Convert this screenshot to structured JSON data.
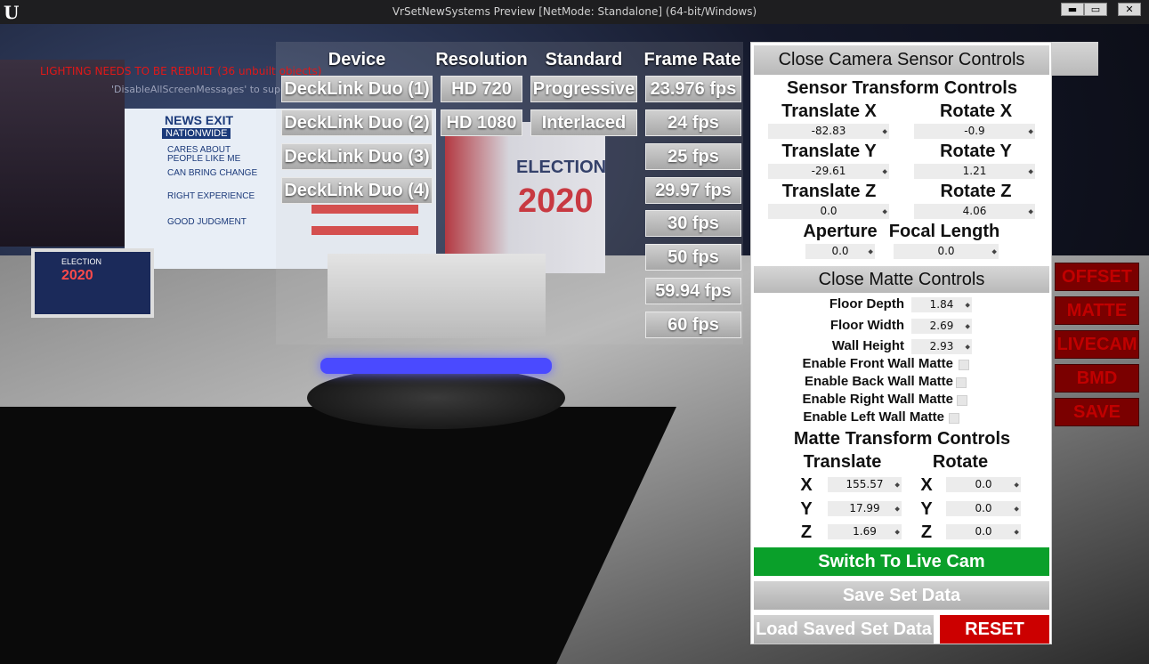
{
  "window": {
    "title": "VrSetNewSystems Preview [NetMode: Standalone]  (64-bit/Windows)",
    "minimize": "▬",
    "maximize": "▭",
    "close": "✕"
  },
  "viewport": {
    "warning": "LIGHTING NEEDS TO BE REBUILT (36 unbuilt objects)",
    "warning_sub": "'DisableAllScreenMessages' to suppress",
    "scene_text": {
      "news_logo": "NEWS EXIT",
      "nationwide": "NATIONWIDE",
      "cares": "CARES ABOUT PEOPLE LIKE ME",
      "can_bring": "CAN BRING CHANGE",
      "right_exp": "RIGHT EXPERIENCE",
      "good_judgment": "GOOD JUDGMENT",
      "election": "ELECTION",
      "year": "2020",
      "small_election": "ELECTION",
      "small_year": "2020"
    }
  },
  "device_panel": {
    "headers": {
      "device": "Device",
      "resolution": "Resolution",
      "standard": "Standard",
      "frame_rate": "Frame Rate"
    },
    "devices": [
      "DeckLink Duo (1)",
      "DeckLink Duo (2)",
      "DeckLink Duo (3)",
      "DeckLink Duo (4)"
    ],
    "resolutions": [
      "HD 720",
      "HD 1080"
    ],
    "standards": [
      "Progressive",
      "Interlaced"
    ],
    "frame_rates": [
      "23.976 fps",
      "24 fps",
      "25 fps",
      "29.97 fps",
      "30 fps",
      "50 fps",
      "59.94 fps",
      "60 fps"
    ]
  },
  "camera_panel": {
    "close_sensor": "Close Camera Sensor Controls",
    "sensor_title": "Sensor Transform Controls",
    "translate_x_label": "Translate X",
    "translate_x": "-82.83",
    "rotate_x_label": "Rotate X",
    "rotate_x": "-0.9",
    "translate_y_label": "Translate Y",
    "translate_y": "-29.61",
    "rotate_y_label": "Rotate Y",
    "rotate_y": "1.21",
    "translate_z_label": "Translate Z",
    "translate_z": "0.0",
    "rotate_z_label": "Rotate Z",
    "rotate_z": "4.06",
    "aperture_label": "Aperture",
    "aperture": "0.0",
    "focal_label": "Focal Length",
    "focal": "0.0",
    "close_matte": "Close Matte Controls",
    "floor_depth_label": "Floor Depth",
    "floor_depth": "1.84",
    "floor_width_label": "Floor Width",
    "floor_width": "2.69",
    "wall_height_label": "Wall Height",
    "wall_height": "2.93",
    "front_wall": "Enable Front Wall Matte",
    "back_wall": "Enable Back Wall Matte",
    "right_wall": "Enable Right Wall Matte",
    "left_wall": "Enable Left Wall Matte",
    "matte_title": "Matte Transform Controls",
    "translate_label": "Translate",
    "rotate_label": "Rotate",
    "x": "X",
    "y": "Y",
    "z": "Z",
    "m_tx": "155.57",
    "m_ty": "17.99",
    "m_tz": "1.69",
    "m_rx": "0.0",
    "m_ry": "0.0",
    "m_rz": "0.0",
    "live_cam": "Switch To Live Cam",
    "save_set": "Save Set Data",
    "load_set": "Load Saved Set Data",
    "reset": "RESET"
  },
  "side_buttons": [
    "OFFSET",
    "MATTE",
    "LIVECAM",
    "BMD",
    "SAVE"
  ],
  "colors": {
    "live_green": "#0aa02a",
    "reset_red": "#cc0000",
    "side_red": "#7a0000"
  }
}
